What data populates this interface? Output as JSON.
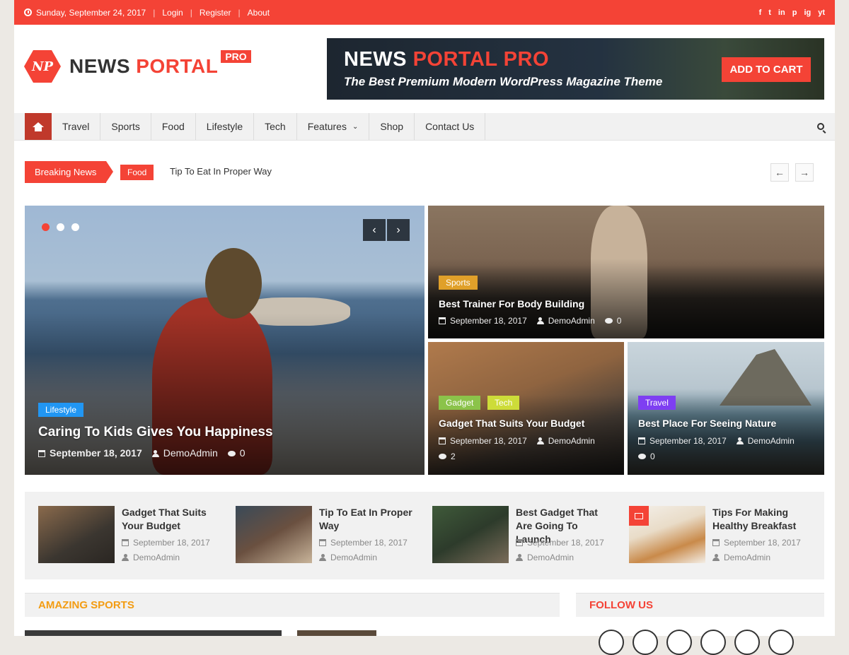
{
  "topbar": {
    "date": "Sunday, September 24, 2017",
    "links": [
      "Login",
      "Register",
      "About"
    ],
    "social_icons": [
      "facebook-icon",
      "twitter-icon",
      "linkedin-icon",
      "pinterest-icon",
      "instagram-icon",
      "youtube-icon"
    ],
    "social_glyphs": [
      "f",
      "t",
      "in",
      "p",
      "ig",
      "yt"
    ]
  },
  "logo": {
    "monogram": "NP",
    "name_part1": "NEWS",
    "name_part2": "PORTAL",
    "badge": "PRO"
  },
  "banner": {
    "title_part1": "NEWS",
    "title_part2": "PORTAL PRO",
    "subtitle": "The Best Premium Modern WordPress Magazine Theme",
    "cart_label": "ADD TO CART"
  },
  "nav": {
    "items": [
      "Travel",
      "Sports",
      "Food",
      "Lifestyle",
      "Tech",
      "Features",
      "Shop",
      "Contact Us"
    ]
  },
  "ticker": {
    "label": "Breaking News",
    "category": "Food",
    "headline": "Tip To Eat In Proper Way",
    "prev": "←",
    "next": "→"
  },
  "slider": {
    "tag": "Lifestyle",
    "title": "Caring To Kids Gives You Happiness",
    "date": "September 18, 2017",
    "author": "DemoAdmin",
    "comments": "0",
    "prev": "‹",
    "next": "›"
  },
  "featured": [
    {
      "tags": [
        "Sports"
      ],
      "title": "Best Trainer For Body Building",
      "date": "September 18, 2017",
      "author": "DemoAdmin",
      "comments": "0"
    },
    {
      "tags": [
        "Gadget",
        "Tech"
      ],
      "title": "Gadget That Suits Your Budget",
      "date": "September 18, 2017",
      "author": "DemoAdmin",
      "comments": "2"
    },
    {
      "tags": [
        "Travel"
      ],
      "title": "Best Place For Seeing Nature",
      "date": "September 18, 2017",
      "author": "DemoAdmin",
      "comments": "0"
    }
  ],
  "strip": [
    {
      "title": "Gadget That Suits Your Budget",
      "date": "September 18, 2017",
      "author": "DemoAdmin"
    },
    {
      "title": "Tip To Eat In Proper Way",
      "date": "September 18, 2017",
      "author": "DemoAdmin"
    },
    {
      "title": "Best Gadget That Are Going To Launch",
      "date": "September 18, 2017",
      "author": "DemoAdmin"
    },
    {
      "title": "Tips For Making Healthy Breakfast",
      "date": "September 18, 2017",
      "author": "DemoAdmin"
    }
  ],
  "sections": {
    "left": "AMAZING SPORTS",
    "right": "FOLLOW US"
  },
  "colors": {
    "accent": "#f44336",
    "sports": "#e0a02a",
    "gadget": "#8bc34a",
    "tech": "#cddc39",
    "travel": "#7e3ff2",
    "lifestyle": "#2196f3",
    "section_title": "#f39c12"
  }
}
